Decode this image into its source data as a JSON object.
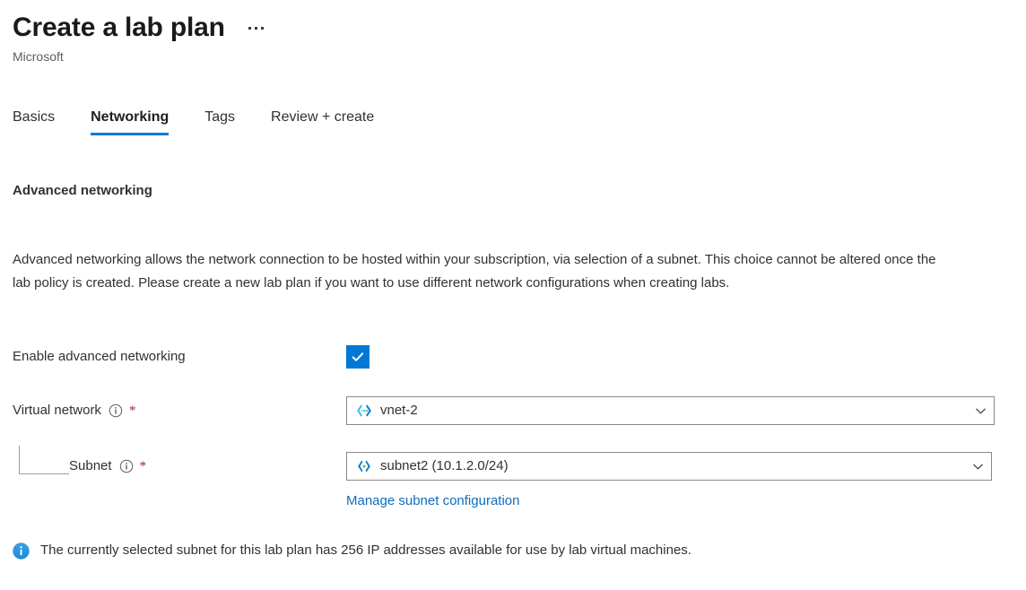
{
  "header": {
    "title": "Create a lab plan",
    "subtitle": "Microsoft",
    "more_menu_label": "..."
  },
  "tabs": [
    {
      "label": "Basics",
      "active": false
    },
    {
      "label": "Networking",
      "active": true
    },
    {
      "label": "Tags",
      "active": false
    },
    {
      "label": "Review + create",
      "active": false
    }
  ],
  "section": {
    "heading": "Advanced networking",
    "description": "Advanced networking allows the network connection to be hosted within your subscription, via selection of a subnet. This choice cannot be altered once the lab policy is created. Please create a new lab plan if you want to use different network configurations when creating labs."
  },
  "form": {
    "enable_advanced_networking": {
      "label": "Enable advanced networking",
      "checked": true
    },
    "virtual_network": {
      "label": "Virtual network",
      "required_marker": "*",
      "value": "vnet-2",
      "icon": "virtual-network-icon"
    },
    "subnet": {
      "label": "Subnet",
      "required_marker": "*",
      "value": "subnet2 (10.1.2.0/24)",
      "icon": "subnet-icon"
    },
    "manage_link": "Manage subnet configuration"
  },
  "info_message": {
    "text": "The currently selected subnet for this lab plan has 256 IP addresses available for use by lab virtual machines.",
    "icon": "info-filled-icon"
  },
  "colors": {
    "accent": "#0078d4",
    "link": "#0f6cbd",
    "required": "#a4262c",
    "border": "#8a8886",
    "text": "#323130",
    "muted": "#605e5c"
  }
}
